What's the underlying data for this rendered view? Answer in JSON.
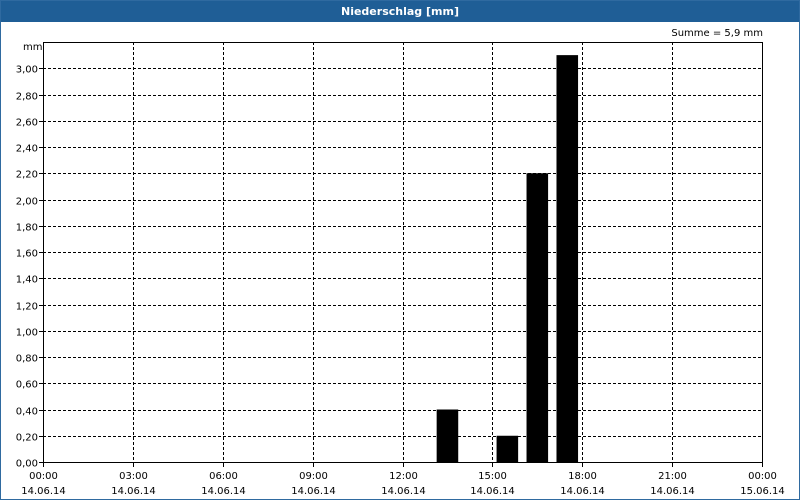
{
  "window": {
    "title": "Niederschlag [mm]"
  },
  "chart_data": {
    "type": "bar",
    "title": "Niederschlag [mm]",
    "ylabel": "mm",
    "annotation": "Summe = 5,9 mm",
    "ylim": [
      0,
      3.2
    ],
    "grid": true,
    "y_ticks": [
      "0,00",
      "0,20",
      "0,40",
      "0,60",
      "0,80",
      "1,00",
      "1,20",
      "1,40",
      "1,60",
      "1,80",
      "2,00",
      "2,20",
      "2,40",
      "2,60",
      "2,80",
      "3,00"
    ],
    "y_tick_values": [
      0,
      0.2,
      0.4,
      0.6,
      0.8,
      1.0,
      1.2,
      1.4,
      1.6,
      1.8,
      2.0,
      2.2,
      2.4,
      2.6,
      2.8,
      3.0
    ],
    "x_ticks": [
      {
        "time": "00:00",
        "date": "14.06.14",
        "hour": 0
      },
      {
        "time": "03:00",
        "date": "14.06.14",
        "hour": 3
      },
      {
        "time": "06:00",
        "date": "14.06.14",
        "hour": 6
      },
      {
        "time": "09:00",
        "date": "14.06.14",
        "hour": 9
      },
      {
        "time": "12:00",
        "date": "14.06.14",
        "hour": 12
      },
      {
        "time": "15:00",
        "date": "14.06.14",
        "hour": 15
      },
      {
        "time": "18:00",
        "date": "14.06.14",
        "hour": 18
      },
      {
        "time": "21:00",
        "date": "14.06.14",
        "hour": 21
      },
      {
        "time": "00:00",
        "date": "15.06.14",
        "hour": 24
      }
    ],
    "xlim_hours": [
      0,
      24
    ],
    "bars": [
      {
        "start": "13:00",
        "end": "14:00",
        "start_hour": 13,
        "end_hour": 14,
        "value": 0.4
      },
      {
        "start": "15:00",
        "end": "16:00",
        "start_hour": 15,
        "end_hour": 16,
        "value": 0.2
      },
      {
        "start": "16:00",
        "end": "17:00",
        "start_hour": 16,
        "end_hour": 17,
        "value": 2.2
      },
      {
        "start": "17:00",
        "end": "18:00",
        "start_hour": 17,
        "end_hour": 18,
        "value": 3.1
      }
    ],
    "bar_color": "#000000"
  }
}
